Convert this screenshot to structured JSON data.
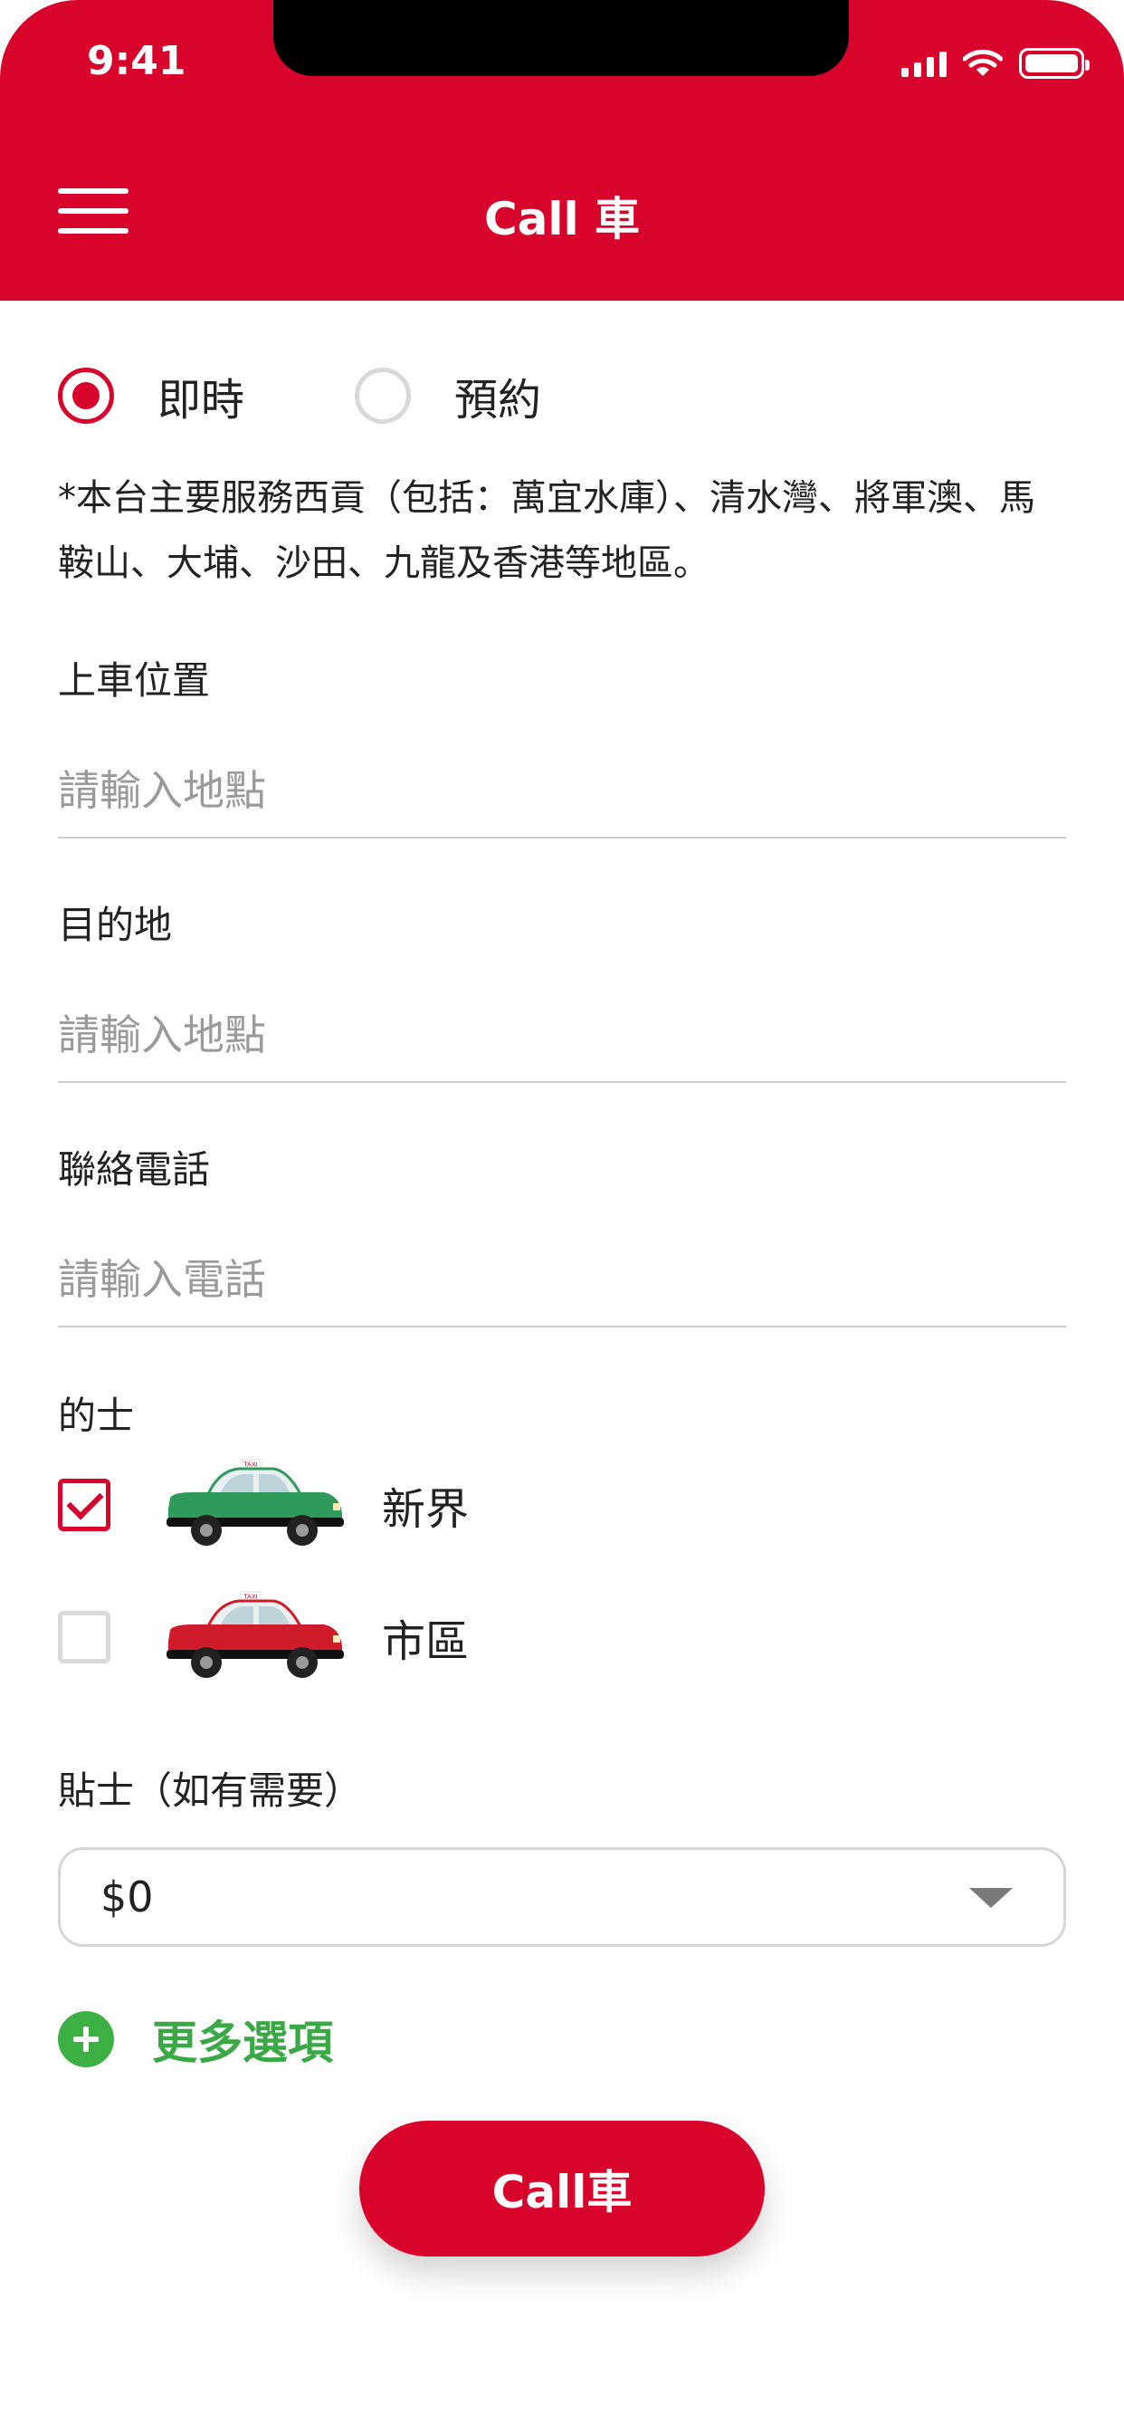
{
  "status_bar": {
    "time": "9:41"
  },
  "header": {
    "title": "Call 車",
    "menu_icon": "hamburger-menu-icon"
  },
  "booking_mode": {
    "options": [
      {
        "label": "即時",
        "selected": true
      },
      {
        "label": "預約",
        "selected": false
      }
    ]
  },
  "notice": "*本台主要服務西貢（包括：萬宜水庫）、清水灣、將軍澳、馬鞍山、大埔、沙田、九龍及香港等地區。",
  "fields": {
    "pickup": {
      "label": "上車位置",
      "placeholder": "請輸入地點"
    },
    "destination": {
      "label": "目的地",
      "placeholder": "請輸入地點"
    },
    "phone": {
      "label": "聯絡電話",
      "placeholder": "請輸入電話"
    }
  },
  "taxi": {
    "label": "的士",
    "options": [
      {
        "label": "新界",
        "checked": true,
        "color": "#2e9a5c",
        "icon": "green-taxi-icon"
      },
      {
        "label": "市區",
        "checked": false,
        "color": "#d01c2a",
        "icon": "red-taxi-icon"
      }
    ]
  },
  "tip": {
    "label": "貼士（如有需要）",
    "value": "$0"
  },
  "more_options": {
    "label": "更多選項",
    "color": "#3aa845"
  },
  "call_button": {
    "label": "Call車"
  },
  "colors": {
    "brand_red": "#d9042b",
    "accent_green": "#3cb043"
  }
}
